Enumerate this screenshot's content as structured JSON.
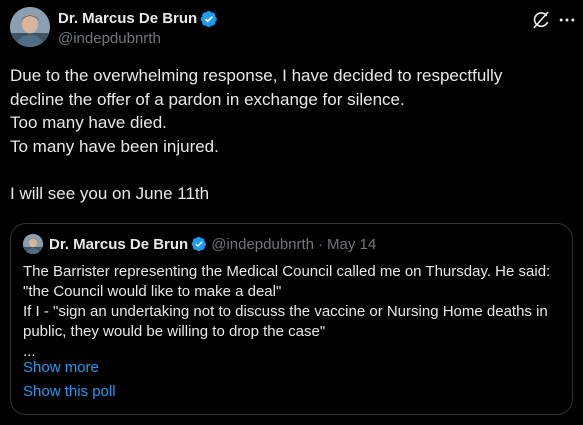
{
  "author": {
    "display_name": "Dr. Marcus De Brun",
    "handle": "@indepdubnrth"
  },
  "post": {
    "lines": [
      "Due to the overwhelming response, I have decided to respectfully",
      "decline the offer of a pardon in exchange for silence.",
      "Too many have died.",
      "To many have been injured.",
      "",
      "I will see you on June 11th"
    ]
  },
  "quote": {
    "display_name": "Dr. Marcus De Brun",
    "handle": "@indepdubnrth",
    "separator": "·",
    "date": "May 14",
    "lines": [
      "The Barrister representing the Medical Council called me on Thursday. He said:",
      "\"the Council would like to make a deal\"",
      "If I - \"sign an undertaking not to discuss the vaccine or Nursing Home deaths in",
      "public, they would be willing to drop the case\"",
      "..."
    ],
    "show_more": "Show more",
    "show_poll": "Show this poll"
  },
  "icons": {
    "verified": "verified-badge-icon",
    "grok": "grok-icon",
    "more": "more-options-icon"
  },
  "colors": {
    "background": "#000000",
    "text": "#e7e9ea",
    "muted": "#71767b",
    "accent": "#1d9bf0",
    "border": "#2f3336"
  }
}
